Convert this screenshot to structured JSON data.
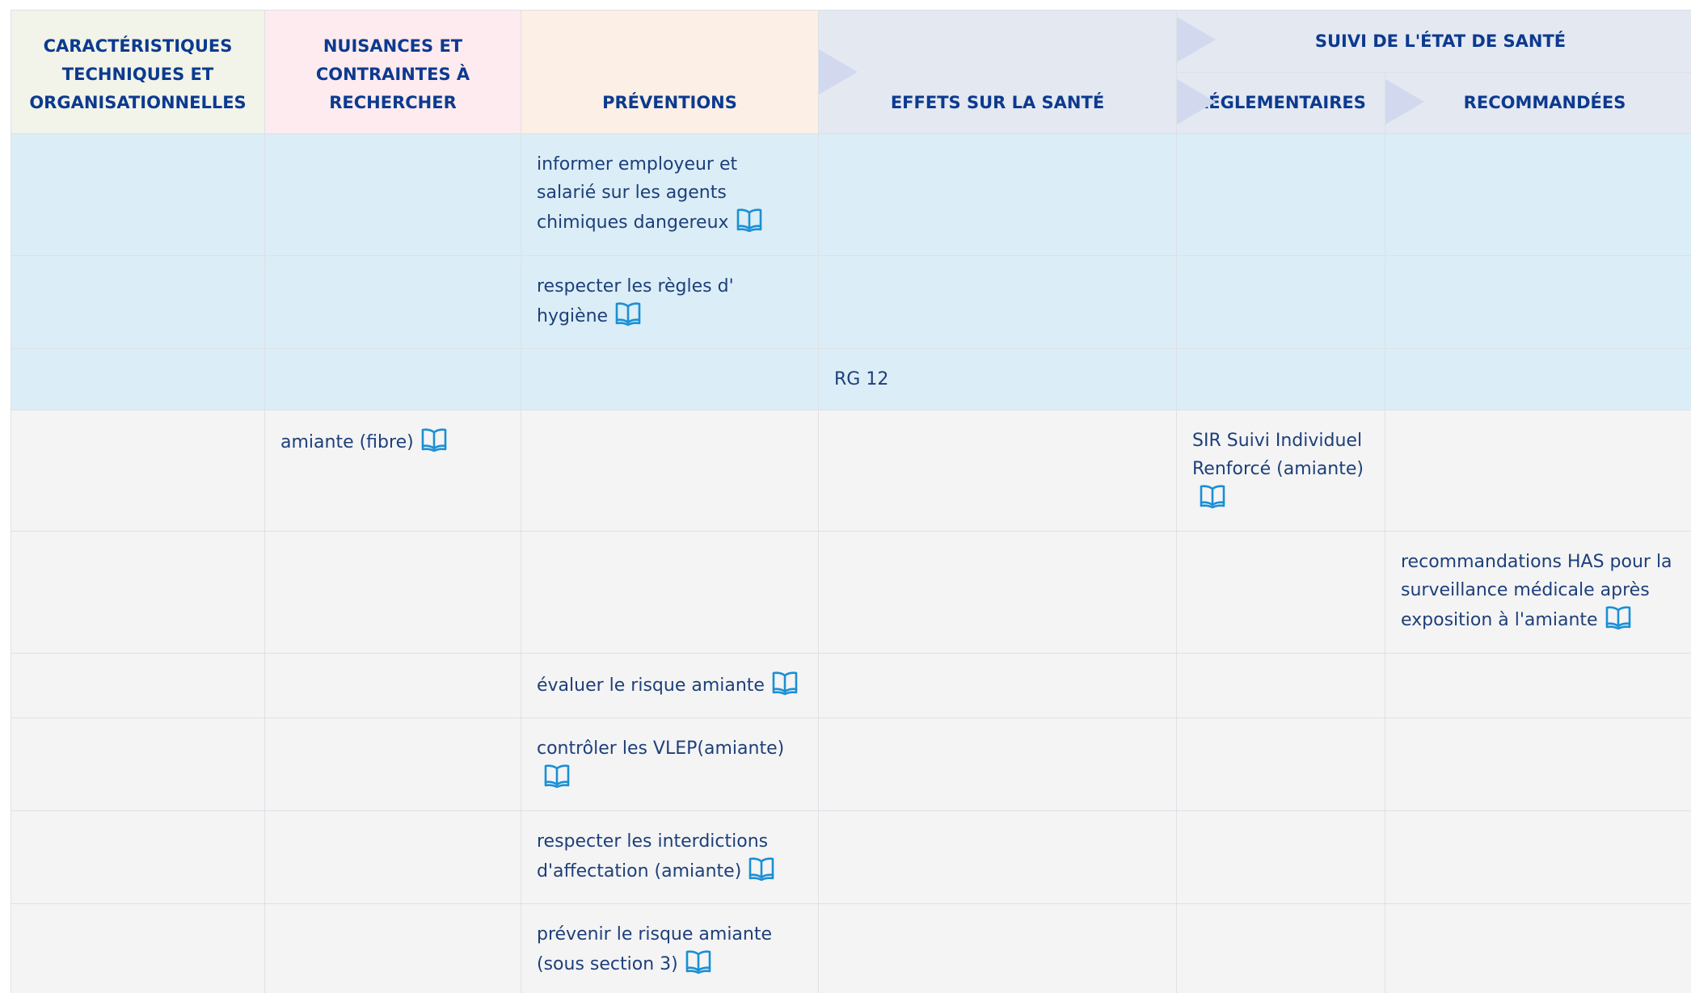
{
  "headers": {
    "tech": "CARACTÉRISTIQUES TECHNIQUES ET ORGANISATIONNELLES",
    "nuisances": "NUISANCES ET CONTRAINTES À RECHERCHER",
    "preventions": "PRÉVENTIONS",
    "effets": "EFFETS SUR LA SANTÉ",
    "suivi": "SUIVI DE L'ÉTAT DE SANTÉ",
    "reglementaires": "RÉGLEMENTAIRES",
    "recommandees": "RECOMMANDÉES"
  },
  "rows": [
    {
      "style": "blue",
      "prevention": "informer employeur et salarié sur les agents chimiques dangereux"
    },
    {
      "style": "blue",
      "prevention": "respecter les règles d' hygiène"
    },
    {
      "style": "blue",
      "effet": "RG 12"
    },
    {
      "style": "grey",
      "nuisance": "amiante (fibre)",
      "reglementaire": "SIR Suivi Individuel Renforcé (amiante)"
    },
    {
      "style": "grey",
      "recommandee": "recommandations HAS pour la surveillance médicale après exposition à l'amiante"
    },
    {
      "style": "grey",
      "prevention": "évaluer le risque amiante"
    },
    {
      "style": "grey",
      "prevention": "contrôler les VLEP(amiante)"
    },
    {
      "style": "grey",
      "prevention": "respecter les interdictions d'affectation (amiante)"
    },
    {
      "style": "grey",
      "prevention": "prévenir le risque amiante (sous section 3)"
    }
  ],
  "icons": {
    "reference": "book-icon"
  },
  "colors": {
    "header_text": "#0c3a8f",
    "cell_text": "#1d3f7a",
    "icon": "#1a8fd6",
    "blue_row": "#dbedf6",
    "grey_row": "#f4f4f4"
  }
}
